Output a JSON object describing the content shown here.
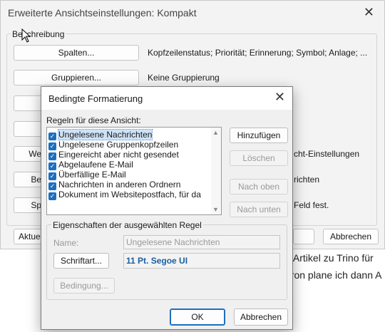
{
  "back_dialog": {
    "title": "Erweiterte Ansichtseinstellungen: Kompakt",
    "close_glyph": "✕",
    "group_label": "Beschreibung",
    "rows": [
      {
        "button": "Spalten...",
        "info": "Kopfzeilenstatus; Priorität; Erinnerung; Symbol; Anlage; ..."
      },
      {
        "button": "Gruppieren...",
        "info": "Keine Gruppierung"
      },
      {
        "button": "",
        "info": ""
      },
      {
        "button": "",
        "info": ""
      },
      {
        "button": "We",
        "info": "cht-Einstellungen"
      },
      {
        "button": "Be",
        "info": "richten"
      },
      {
        "button": "Sp",
        "info": "Feld fest."
      }
    ],
    "bottom_left_button": "Aktue",
    "cancel_label": "Abbrechen"
  },
  "background_text": {
    "line1": "n Artikel zu Trino für",
    "line2": "eron plane ich dann A"
  },
  "modal": {
    "title": "Bedingte Formatierung",
    "close_glyph": "✕",
    "rules_label": "Regeln für diese Ansicht:",
    "rules": [
      {
        "label": "Ungelesene Nachrichten",
        "checked": true,
        "selected": true
      },
      {
        "label": "Ungelesene Gruppenkopfzeilen",
        "checked": true,
        "selected": false
      },
      {
        "label": "Eingereicht aber nicht gesendet",
        "checked": true,
        "selected": false
      },
      {
        "label": "Abgelaufene E-Mail",
        "checked": true,
        "selected": false
      },
      {
        "label": "Überfällige E-Mail",
        "checked": true,
        "selected": false
      },
      {
        "label": "Nachrichten in anderen Ordnern",
        "checked": true,
        "selected": false
      },
      {
        "label": "Dokument im Websitepostfach, für da",
        "checked": true,
        "selected": false
      }
    ],
    "buttons": {
      "add": "Hinzufügen",
      "delete": "Löschen",
      "move_up": "Nach oben",
      "move_down": "Nach unten"
    },
    "properties": {
      "group_label": "Eigenschaften der ausgewählten Regel",
      "name_label": "Name:",
      "name_value": "Ungelesene Nachrichten",
      "font_button": "Schriftart...",
      "font_preview": "11 Pt. Segoe UI",
      "condition_button": "Bedingung..."
    },
    "ok_label": "OK",
    "cancel_label": "Abbrechen"
  },
  "colors": {
    "accent": "#1c6fbf",
    "selection": "#cfe3f7",
    "font_preview": "#1a5fa0"
  }
}
